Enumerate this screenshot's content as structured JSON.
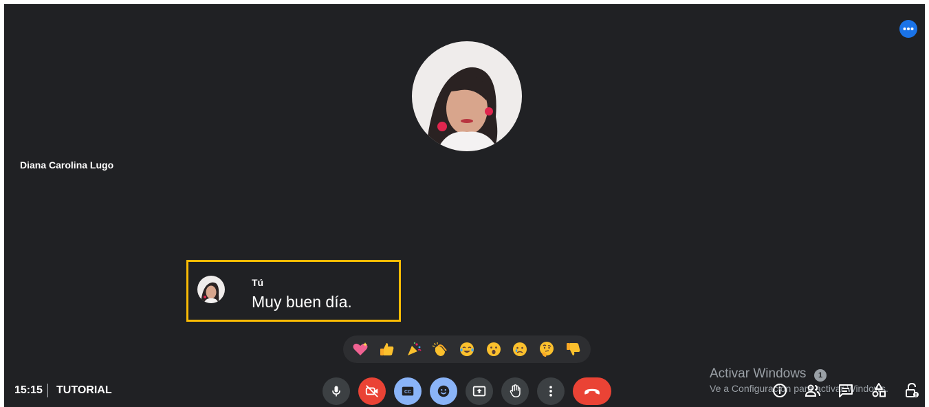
{
  "participant": {
    "name": "Diana Carolina Lugo"
  },
  "caption": {
    "speaker": "Tú",
    "text": "Muy buen día."
  },
  "meeting": {
    "time": "15:15",
    "name": "TUTORIAL"
  },
  "reactions": [
    {
      "name": "sparkling-heart",
      "glyph": "💖"
    },
    {
      "name": "thumbs-up",
      "glyph": "👍"
    },
    {
      "name": "party-popper",
      "glyph": "🎉"
    },
    {
      "name": "clapping-hands",
      "glyph": "👏"
    },
    {
      "name": "tears-of-joy",
      "glyph": "😂"
    },
    {
      "name": "surprised",
      "glyph": "😮"
    },
    {
      "name": "crying",
      "glyph": "😢"
    },
    {
      "name": "thinking",
      "glyph": "🤔"
    },
    {
      "name": "thumbs-down",
      "glyph": "👎"
    }
  ],
  "controls": [
    {
      "name": "mic-button",
      "icon": "mic-icon",
      "style": "gray"
    },
    {
      "name": "camera-off-button",
      "icon": "camera-off-icon",
      "style": "red"
    },
    {
      "name": "captions-button",
      "icon": "captions-icon",
      "style": "blue"
    },
    {
      "name": "emoji-button",
      "icon": "emoji-icon",
      "style": "blue"
    },
    {
      "name": "present-button",
      "icon": "present-icon",
      "style": "gray"
    },
    {
      "name": "raise-hand-button",
      "icon": "hand-icon",
      "style": "gray"
    },
    {
      "name": "more-options-button",
      "icon": "more-vert-icon",
      "style": "gray"
    },
    {
      "name": "end-call-button",
      "icon": "phone-hangup-icon",
      "style": "red"
    }
  ],
  "side_icons": [
    "info-icon",
    "people-icon",
    "chat-icon",
    "activities-icon",
    "host-controls-icon"
  ],
  "watermark": {
    "title": "Activar Windows",
    "subtitle": "Ve a Configuración para activar Windows.",
    "badge": "1"
  },
  "colors": {
    "background": "#202124",
    "highlight": "#fbbc04",
    "end_call": "#ea4335",
    "accent_blue": "#8ab4f8",
    "more_button": "#1a73e8"
  }
}
